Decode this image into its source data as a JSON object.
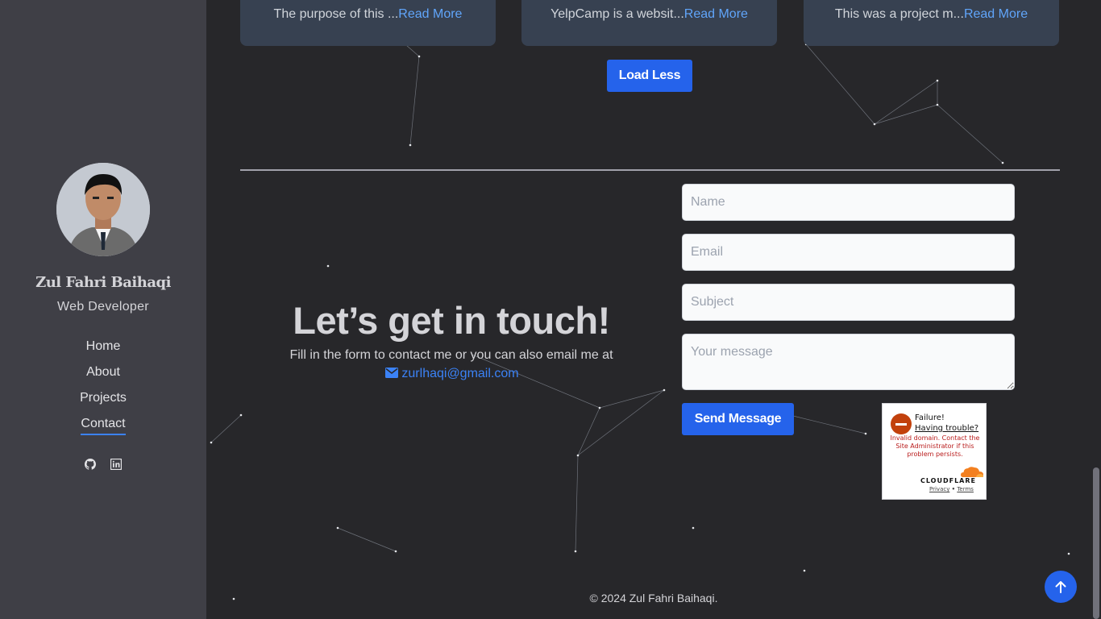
{
  "sidebar": {
    "name": "Zul Fahri Baihaqi",
    "role": "Web Developer",
    "nav": [
      {
        "label": "Home",
        "active": false
      },
      {
        "label": "About",
        "active": false
      },
      {
        "label": "Projects",
        "active": false
      },
      {
        "label": "Contact",
        "active": true
      }
    ],
    "socials": [
      "github-icon",
      "linkedin-icon"
    ]
  },
  "projects": {
    "cards": [
      {
        "snippet": "The purpose of this ...",
        "read_more": "Read More"
      },
      {
        "snippet": "YelpCamp is a websit...",
        "read_more": "Read More"
      },
      {
        "snippet": "This was a project m...",
        "read_more": "Read More"
      }
    ],
    "load_less_label": "Load Less"
  },
  "contact": {
    "title": "Let’s get in touch!",
    "subtitle": "Fill in the form to contact me or you can also email me at",
    "email": "zurlhaqi@gmail.com",
    "form": {
      "name_placeholder": "Name",
      "email_placeholder": "Email",
      "subject_placeholder": "Subject",
      "message_placeholder": "Your message",
      "send_label": "Send Message"
    }
  },
  "captcha": {
    "status": "Failure!",
    "help_link": "Having trouble?",
    "message": "Invalid domain. Contact the Site Administrator if this problem persists.",
    "brand": "CLOUDFLARE",
    "privacy": "Privacy",
    "separator": "•",
    "terms": "Terms"
  },
  "footer": {
    "copyright": "© 2024 Zul Fahri Baihaqi."
  },
  "colors": {
    "accent": "#2563eb",
    "sidebar_bg": "#3f3f46",
    "main_bg": "#27272a"
  }
}
